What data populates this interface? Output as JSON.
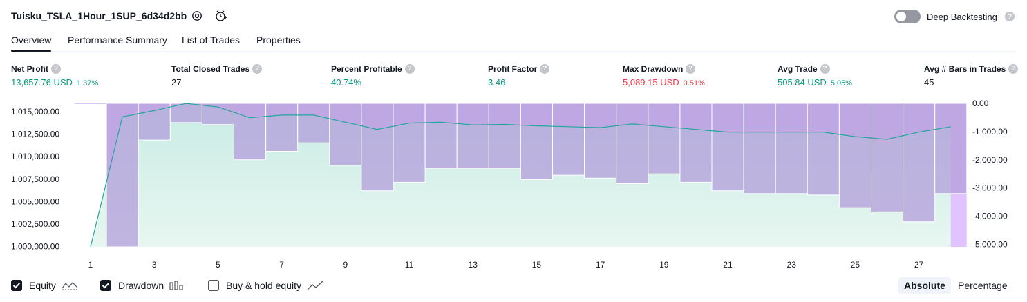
{
  "header": {
    "strategy_name": "Tuisku_TSLA_1Hour_1SUP_6d34d2bb",
    "deep_backtesting_label": "Deep Backtesting",
    "deep_backtesting_enabled": false,
    "icons": [
      "settings-icon",
      "add-alert-icon",
      "help-icon"
    ]
  },
  "tabs": [
    {
      "label": "Overview",
      "active": true
    },
    {
      "label": "Performance Summary",
      "active": false
    },
    {
      "label": "List of Trades",
      "active": false
    },
    {
      "label": "Properties",
      "active": false
    }
  ],
  "stats": [
    {
      "label": "Net Profit",
      "value": "13,657.76 USD",
      "pct": "1.37%",
      "color": "#089981"
    },
    {
      "label": "Total Closed Trades",
      "value": "27",
      "pct": "",
      "color": "#131722"
    },
    {
      "label": "Percent Profitable",
      "value": "40.74%",
      "pct": "",
      "color": "#089981"
    },
    {
      "label": "Profit Factor",
      "value": "3.46",
      "pct": "",
      "color": "#089981"
    },
    {
      "label": "Max Drawdown",
      "value": "5,089.15 USD",
      "pct": "0.51%",
      "color": "#f23645"
    },
    {
      "label": "Avg Trade",
      "value": "505.84 USD",
      "pct": "5.05%",
      "color": "#089981"
    },
    {
      "label": "Avg # Bars in Trades",
      "value": "45",
      "pct": "",
      "color": "#131722"
    }
  ],
  "legend": {
    "equity": {
      "label": "Equity",
      "checked": true
    },
    "drawdown": {
      "label": "Drawdown",
      "checked": true
    },
    "buy_hold": {
      "label": "Buy & hold equity",
      "checked": false
    }
  },
  "mode": {
    "absolute": "Absolute",
    "percentage": "Percentage",
    "selected": "Absolute"
  },
  "colors": {
    "equity_line": "#22a69a",
    "equity_fill": "#c8ece4",
    "drawdown_bar": "#b39ddb",
    "drawdown_bg": "#e1c4ff"
  },
  "chart_data": {
    "type": "area",
    "x": [
      1,
      2,
      3,
      4,
      5,
      6,
      7,
      8,
      9,
      10,
      11,
      12,
      13,
      14,
      15,
      16,
      17,
      18,
      19,
      20,
      21,
      22,
      23,
      24,
      25,
      26,
      27,
      28
    ],
    "x_tick_labels": [
      "1",
      "3",
      "5",
      "7",
      "9",
      "11",
      "13",
      "15",
      "17",
      "19",
      "21",
      "23",
      "25",
      "27"
    ],
    "y_left_tick_labels": [
      "1,015,000.00",
      "1,012,500.00",
      "1,010,000.00",
      "1,007,500.00",
      "1,005,000.00",
      "1,002,500.00",
      "1,000,000.00"
    ],
    "y_left_ylim": [
      1000000,
      1016000
    ],
    "y_right_tick_labels": [
      "0.00",
      "-1,000.00",
      "-2,000.00",
      "-3,000.00",
      "-4,000.00",
      "-5,000.00"
    ],
    "y_right_ylim": [
      -5089.15,
      0
    ],
    "series": [
      {
        "name": "Equity",
        "axis": "left",
        "values": [
          1000000,
          1014500,
          1015200,
          1016000,
          1015600,
          1014400,
          1014700,
          1014700,
          1013900,
          1013100,
          1013800,
          1013900,
          1013600,
          1013650,
          1013500,
          1013400,
          1013300,
          1013700,
          1013400,
          1013100,
          1012800,
          1012800,
          1012800,
          1012800,
          1012300,
          1012000,
          1012800,
          1013400
        ]
      },
      {
        "name": "Drawdown",
        "axis": "right",
        "values": [
          0,
          -5089.15,
          -1300,
          -680,
          -750,
          -2000,
          -1700,
          -1400,
          -2200,
          -3100,
          -2800,
          -2300,
          -2300,
          -2300,
          -2700,
          -2550,
          -2650,
          -2850,
          -2500,
          -2800,
          -3100,
          -3200,
          -3200,
          -3250,
          -3700,
          -3850,
          -4200,
          -3200
        ]
      }
    ],
    "grid": false,
    "legend_position": "bottom-left"
  }
}
